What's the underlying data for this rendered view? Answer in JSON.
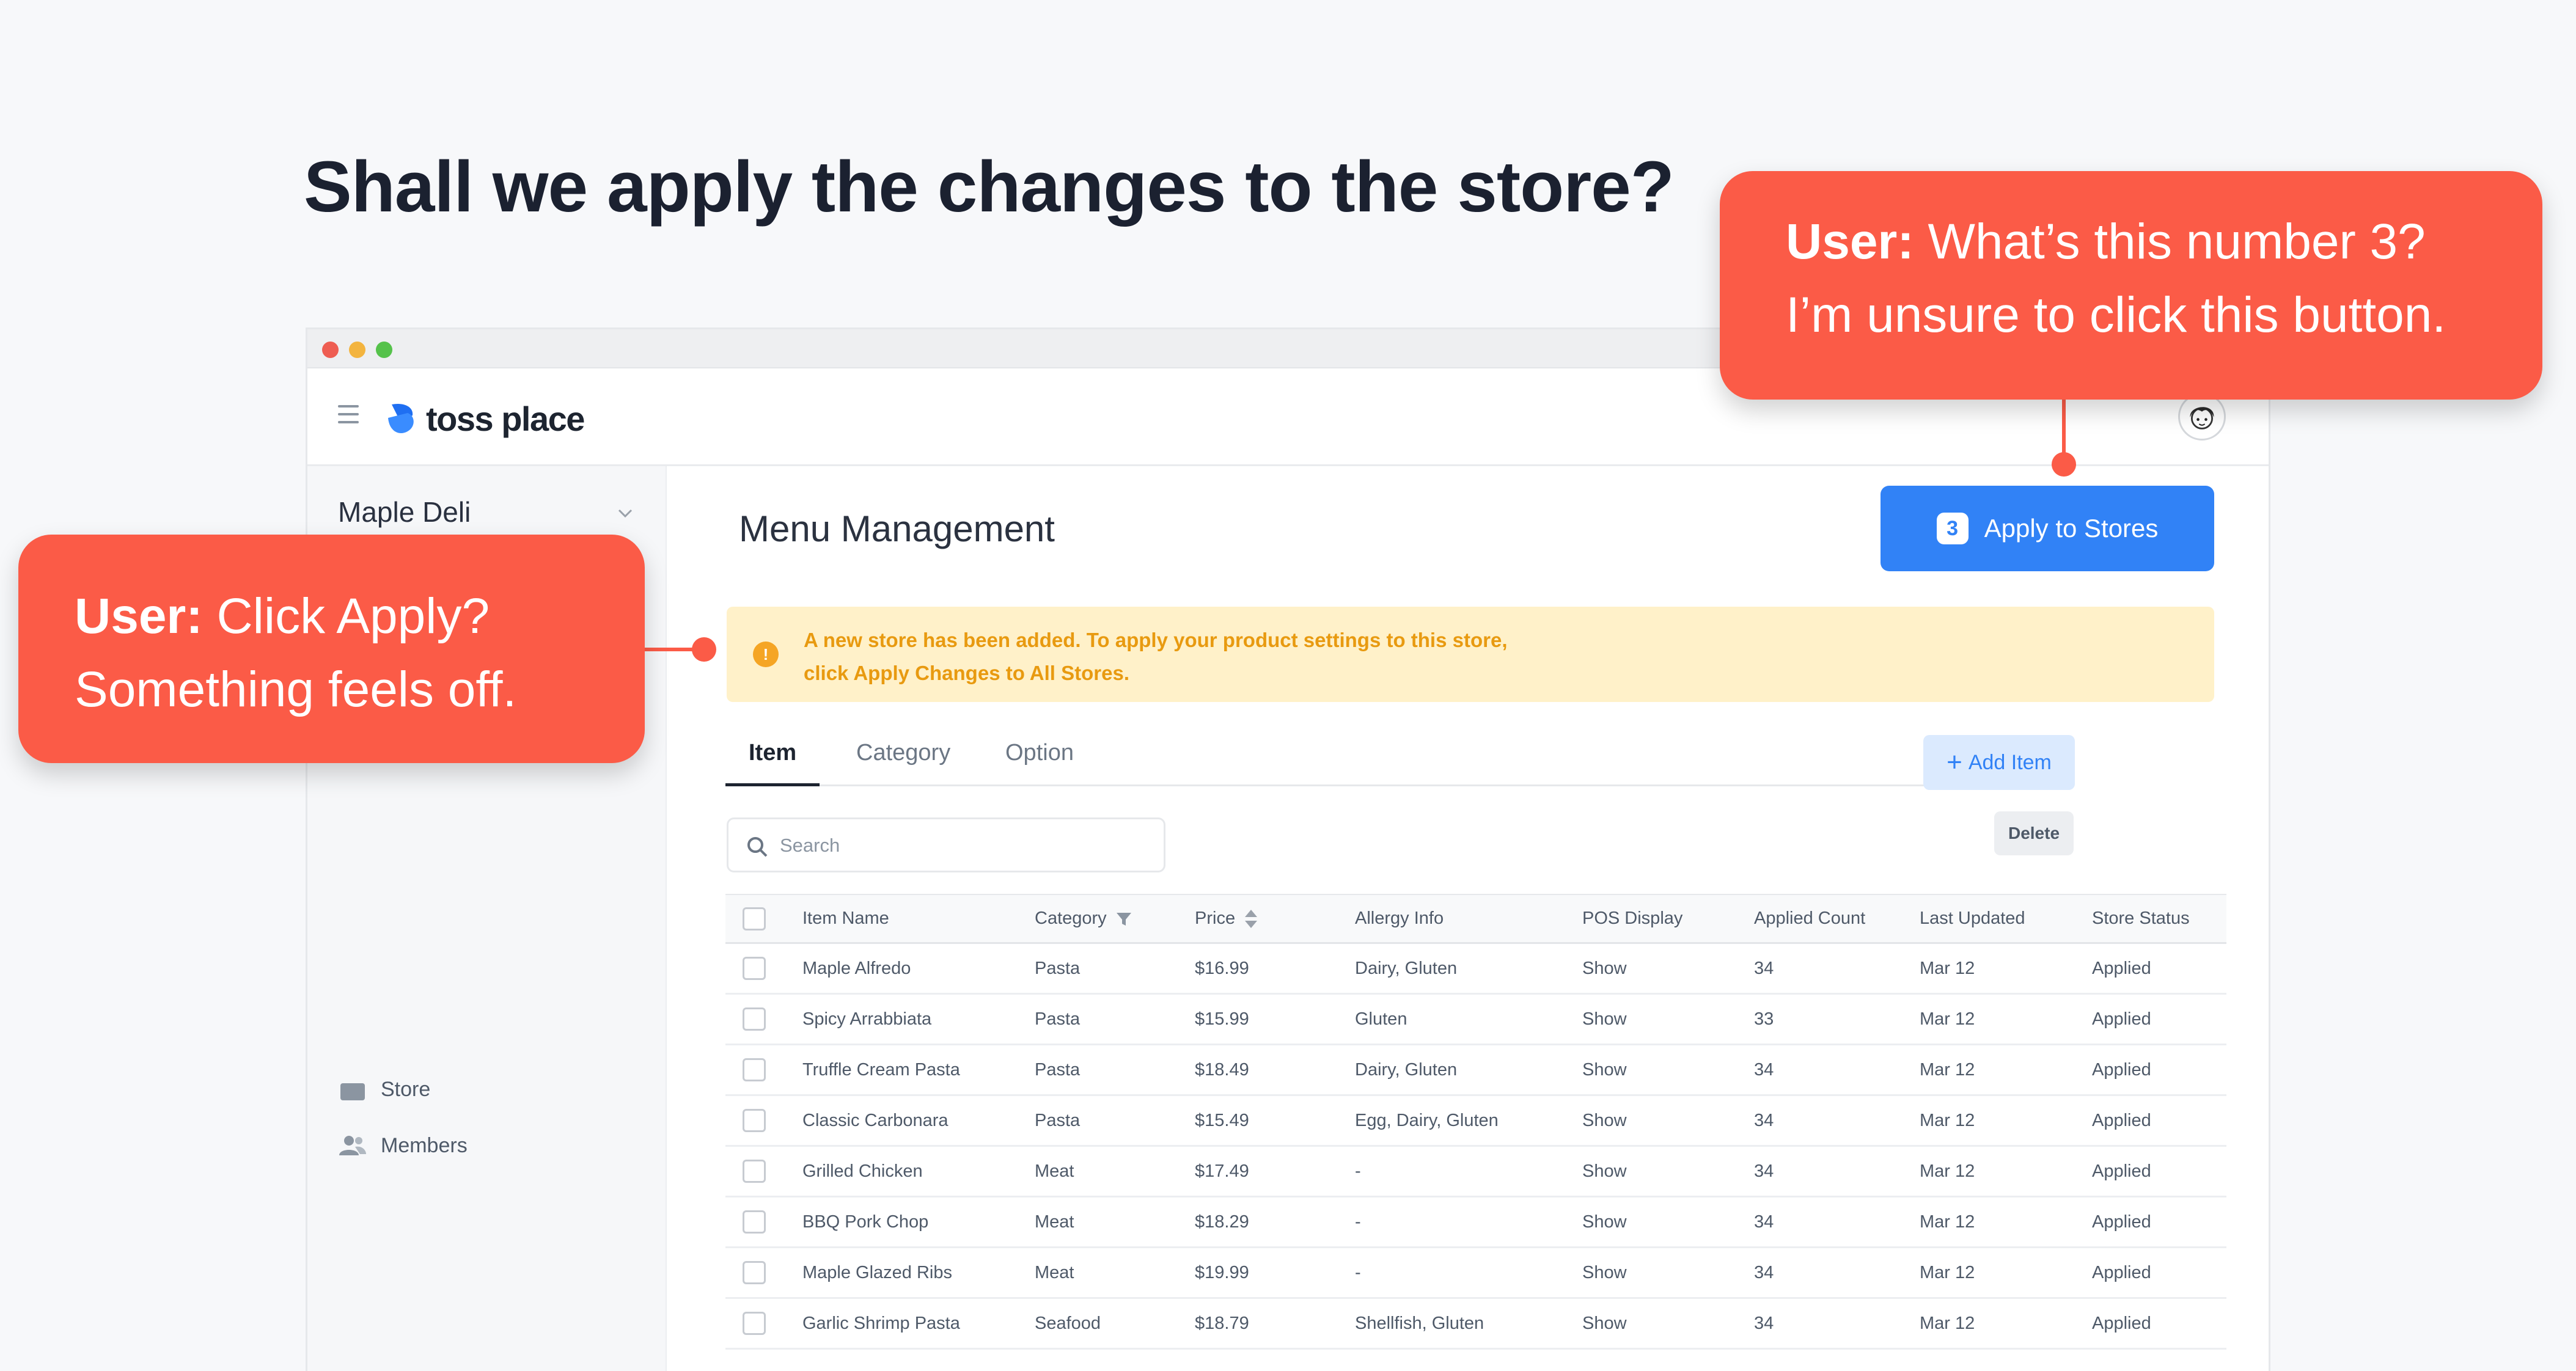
{
  "headline": "Shall we apply the changes to the store?",
  "app": {
    "logo_text": "toss place",
    "sidebar": {
      "store_name": "Maple Deli",
      "items": [
        {
          "label": "Store",
          "icon": "store-icon"
        },
        {
          "label": "Members",
          "icon": "members-icon"
        }
      ]
    },
    "main": {
      "title": "Menu Management",
      "apply_button": {
        "count": "3",
        "label": "Apply to Stores"
      },
      "alert": {
        "line1": "A new store has been added. To apply your product settings to this store,",
        "line2": "click Apply Changes to All Stores."
      },
      "tabs": [
        "Item",
        "Category",
        "Option"
      ],
      "active_tab": "Item",
      "add_button": "Add Item",
      "delete_button": "Delete",
      "search_placeholder": "Search",
      "table": {
        "columns": [
          "Item Name",
          "Category",
          "Price",
          "Allergy Info",
          "POS Display",
          "Applied Count",
          "Last Updated",
          "Store Status"
        ],
        "rows": [
          [
            "Maple Alfredo",
            "Pasta",
            "$16.99",
            "Dairy, Gluten",
            "Show",
            "34",
            "Mar 12",
            "Applied"
          ],
          [
            "Spicy Arrabbiata",
            "Pasta",
            "$15.99",
            "Gluten",
            "Show",
            "33",
            "Mar 12",
            "Applied"
          ],
          [
            "Truffle Cream Pasta",
            "Pasta",
            "$18.49",
            "Dairy, Gluten",
            "Show",
            "34",
            "Mar 12",
            "Applied"
          ],
          [
            "Classic Carbonara",
            "Pasta",
            "$15.49",
            "Egg, Dairy, Gluten",
            "Show",
            "34",
            "Mar 12",
            "Applied"
          ],
          [
            "Grilled Chicken",
            "Meat",
            "$17.49",
            "-",
            "Show",
            "34",
            "Mar 12",
            "Applied"
          ],
          [
            "BBQ Pork Chop",
            "Meat",
            "$18.29",
            "-",
            "Show",
            "34",
            "Mar 12",
            "Applied"
          ],
          [
            "Maple Glazed Ribs",
            "Meat",
            "$19.99",
            "-",
            "Show",
            "34",
            "Mar 12",
            "Applied"
          ],
          [
            "Garlic Shrimp Pasta",
            "Seafood",
            "$18.79",
            "Shellfish, Gluten",
            "Show",
            "34",
            "Mar 12",
            "Applied"
          ]
        ]
      }
    }
  },
  "callouts": [
    {
      "speaker": "User:",
      "line1": "What’s this number 3?",
      "line2": "I’m unsure to click this button."
    },
    {
      "speaker": "User:",
      "line1": "Click Apply?",
      "line2": "Something feels off."
    }
  ],
  "colors": {
    "accent": "#3182f6",
    "callout": "#fb5b47",
    "alert_bg": "#fff1c9",
    "alert_text": "#e89a10"
  }
}
